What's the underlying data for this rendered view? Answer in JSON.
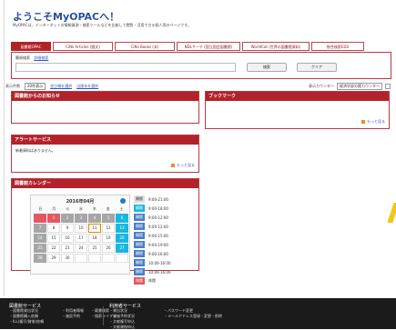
{
  "page": {
    "title": "ようこそMyOPACへ！",
    "subtitle": "MyOPACは、インターネットの情報資源・検索ツールなどを比較して閲覧・活用できる個人用のページです。"
  },
  "tabs": [
    {
      "label": "図書館OPAC",
      "active": true
    },
    {
      "label": "CiNii Articles (論文)"
    },
    {
      "label": "CiNii Books (本)"
    },
    {
      "label": "NDLサーチ (国立国会図書館)"
    },
    {
      "label": "WorldCat (世界の図書館資料)"
    },
    {
      "label": "統合検索EDS"
    }
  ],
  "search": {
    "simple_label": "簡易検索",
    "detail_link": "詳細検索",
    "placeholder": "",
    "search_button": "検索",
    "clear_button": "クリア"
  },
  "options": {
    "display_count_label": "表示件数",
    "display_count_value": "20件表示",
    "sort_link": "並び順を選択",
    "advanced_link": "出版年を選択",
    "campus_label": "表示カウンター",
    "campus_value": "経済学部分館カウンター"
  },
  "panels": {
    "news": {
      "title": "図書館からのお知らせ"
    },
    "bookmark": {
      "title": "ブックマーク",
      "more": "もっと見る"
    },
    "alert": {
      "title": "アラートサービス",
      "message": "新着資料はありません。",
      "more": "もっと見る"
    },
    "calendar": {
      "title": "図書館カレンダー",
      "month": "2016年04月",
      "weekdays": [
        "日",
        "月",
        "火",
        "水",
        "木",
        "金",
        "土"
      ],
      "days": [
        "",
        "1",
        "2",
        "3",
        "4",
        "5",
        "6",
        "7",
        "8",
        "9",
        "10",
        "11",
        "12",
        "13",
        "14",
        "15",
        "16",
        "17",
        "18",
        "19",
        "20",
        "21",
        "22",
        "23",
        "24",
        "25",
        "26",
        "27",
        "28",
        "29",
        "30",
        "",
        "",
        "",
        ""
      ],
      "legend": [
        {
          "name": "開館",
          "time": "9:00-21:00",
          "color": "#e1e1e1"
        },
        {
          "name": "開館",
          "time": "9:00-18:00",
          "color": "#19b7df"
        },
        {
          "name": "開館",
          "time": "9:00-12:00",
          "color": "#4b7dc7"
        },
        {
          "name": "開館",
          "time": "9:00-12:00",
          "color": "#4b7dc7"
        },
        {
          "name": "開館",
          "time": "9:00-15:00",
          "color": "#4b7dc7"
        },
        {
          "name": "開館",
          "time": "9:00-19:00",
          "color": "#4b7dc7"
        },
        {
          "name": "開館",
          "time": "9:00-16:00",
          "color": "#4b7dc7"
        },
        {
          "name": "開館",
          "time": "10:00-16:00",
          "color": "#4b7dc7"
        },
        {
          "name": "開館",
          "time": "10:00-16:00",
          "color": "#4b7dc7"
        },
        {
          "name": "休館",
          "time": "休館",
          "color": "#e15863"
        }
      ]
    }
  },
  "footer": {
    "library_services_title": "図書館サービス",
    "library_items": [
      "・図書館貸出状況",
      "・図書館購入依頼",
      "・ILL(複写/貸借)依頼",
      "・利用者情報",
      "・施設予約",
      "・蔵書検索",
      "・検索ライブラリ"
    ],
    "user_services_title": "利用者サービス",
    "user_items": [
      "・貸出状況",
      "・貸出予約状況",
      "・文献複写申込",
      "・文献貸借申込",
      "・施設予約"
    ],
    "extra_items": [
      "・パスワード変更",
      "・メールアドレス登録・変更・削除"
    ]
  }
}
